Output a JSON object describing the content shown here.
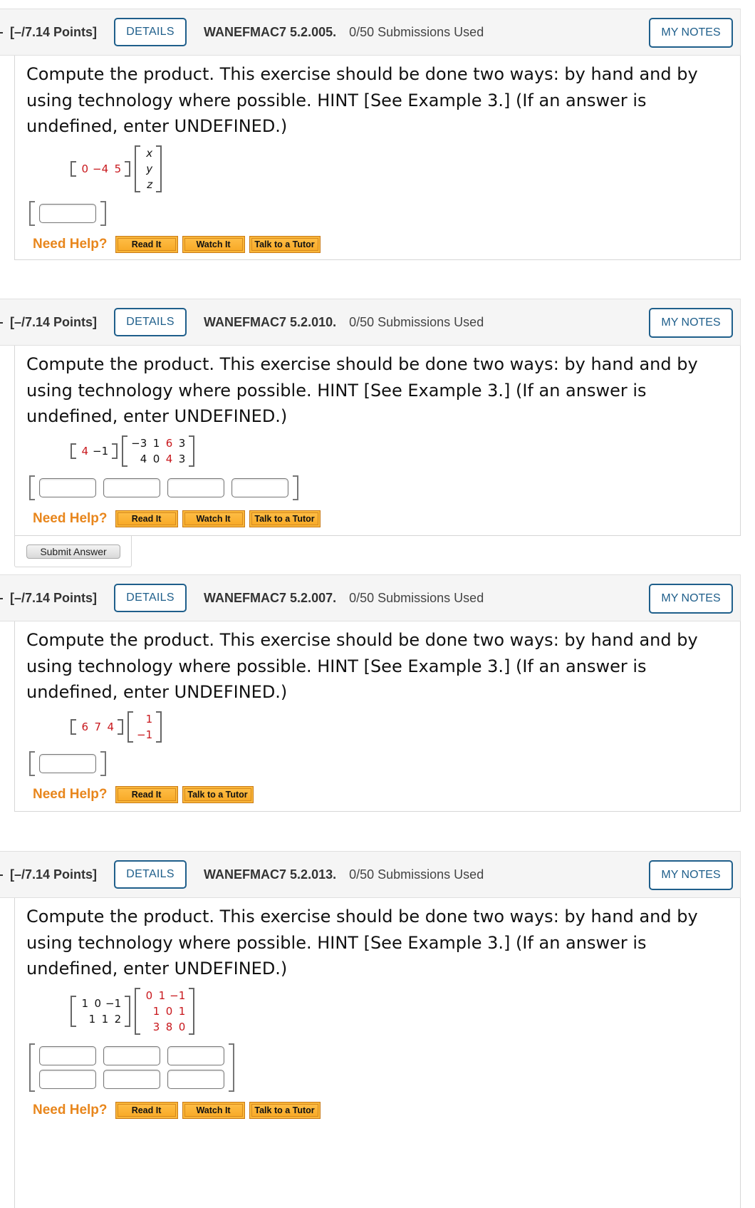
{
  "common": {
    "details_label": "DETAILS",
    "my_notes_label": "MY NOTES",
    "need_help_label": "Need Help?",
    "read_it_label": "Read It",
    "watch_it_label": "Watch It",
    "talk_tutor_label": "Talk to a Tutor",
    "prompt": "Compute the product. This exercise should be done two ways: by hand and by using technology where possible. HINT [See Example 3.] (If an answer is undefined, enter UNDEFINED.)"
  },
  "colors": {
    "accent_blue": "#1f5f8b",
    "help_orange": "#e8861c",
    "matrix_red": "#c8171c",
    "button_orange": "#f7a723"
  },
  "questions": [
    {
      "points": "[–/7.14 Points]",
      "code": "WANEFMAC7 5.2.005.",
      "submissions": "0/50 Submissions Used",
      "left_matrix": [
        [
          {
            "v": "0",
            "red": true
          },
          {
            "v": "−4",
            "red": true
          },
          {
            "v": "5",
            "red": true
          }
        ]
      ],
      "right_matrix": [
        [
          {
            "v": "x",
            "italic": true
          }
        ],
        [
          {
            "v": "y",
            "italic": true
          }
        ],
        [
          {
            "v": "z",
            "italic": true
          }
        ]
      ],
      "answer_shape": [
        1,
        1
      ],
      "help_buttons": [
        "read_it",
        "watch_it",
        "talk_tutor"
      ]
    },
    {
      "points": "[–/7.14 Points]",
      "code": "WANEFMAC7 5.2.010.",
      "submissions": "0/50 Submissions Used",
      "left_matrix": [
        [
          {
            "v": "4",
            "red": true
          },
          {
            "v": "−1"
          }
        ]
      ],
      "right_matrix": [
        [
          {
            "v": "−3"
          },
          {
            "v": "1"
          },
          {
            "v": "6",
            "red": true
          },
          {
            "v": "3"
          }
        ],
        [
          {
            "v": "4"
          },
          {
            "v": "0"
          },
          {
            "v": "4",
            "red": true
          },
          {
            "v": "3"
          }
        ]
      ],
      "answer_shape": [
        1,
        4
      ],
      "help_buttons": [
        "read_it",
        "watch_it",
        "talk_tutor"
      ],
      "submit_label": "Submit Answer"
    },
    {
      "points": "[–/7.14 Points]",
      "code": "WANEFMAC7 5.2.007.",
      "submissions": "0/50 Submissions Used",
      "left_matrix": [
        [
          {
            "v": "6",
            "red": true
          },
          {
            "v": "7",
            "red": true
          },
          {
            "v": "4",
            "red": true
          }
        ]
      ],
      "right_matrix": [
        [
          {
            "v": "1",
            "red": true
          }
        ],
        [
          {
            "v": "−1",
            "red": true
          }
        ]
      ],
      "answer_shape": [
        1,
        1
      ],
      "help_buttons": [
        "read_it",
        "talk_tutor"
      ]
    },
    {
      "points": "[–/7.14 Points]",
      "code": "WANEFMAC7 5.2.013.",
      "submissions": "0/50 Submissions Used",
      "left_matrix": [
        [
          {
            "v": "1"
          },
          {
            "v": "0"
          },
          {
            "v": "−1"
          }
        ],
        [
          {
            "v": "1"
          },
          {
            "v": "1"
          },
          {
            "v": "2"
          }
        ]
      ],
      "right_matrix": [
        [
          {
            "v": "0",
            "red": true
          },
          {
            "v": "1",
            "red": true
          },
          {
            "v": "−1",
            "red": true
          }
        ],
        [
          {
            "v": "1",
            "red": true
          },
          {
            "v": "0",
            "red": true
          },
          {
            "v": "1",
            "red": true
          }
        ],
        [
          {
            "v": "3",
            "red": true
          },
          {
            "v": "8",
            "red": true
          },
          {
            "v": "0",
            "red": true
          }
        ]
      ],
      "answer_shape": [
        2,
        3
      ],
      "help_buttons": [
        "read_it",
        "watch_it",
        "talk_tutor"
      ]
    }
  ]
}
